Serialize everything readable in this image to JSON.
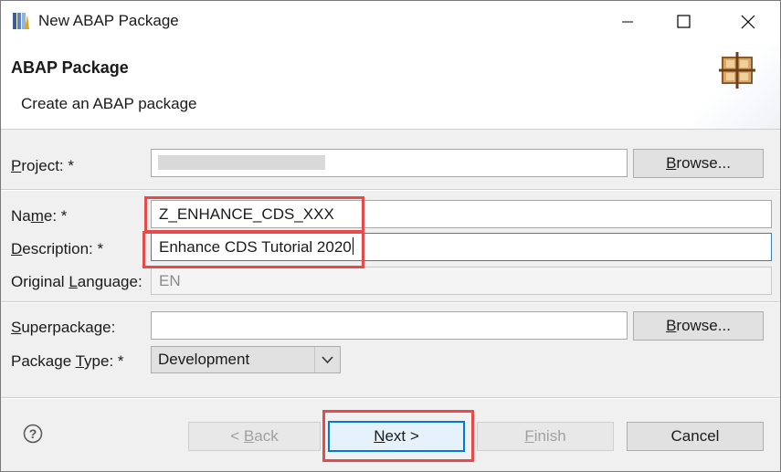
{
  "window": {
    "title": "New ABAP Package"
  },
  "header": {
    "title": "ABAP Package",
    "subtitle": "Create an ABAP package"
  },
  "form": {
    "project": {
      "label_u": "P",
      "label_rest": "roject: *",
      "value": ""
    },
    "name": {
      "label_pre": "Na",
      "label_u": "m",
      "label_rest": "e: *",
      "value": "Z_ENHANCE_CDS_XXX"
    },
    "description": {
      "label_u": "D",
      "label_rest": "escription: *",
      "value": "Enhance CDS Tutorial 2020"
    },
    "original_language": {
      "label_pre": "Original ",
      "label_u": "L",
      "label_rest": "anguage:",
      "value": "EN"
    },
    "superpackage": {
      "label_u": "S",
      "label_rest": "uperpackage:",
      "value": ""
    },
    "package_type": {
      "label_pre": "Package ",
      "label_u": "T",
      "label_rest": "ype: *",
      "value": "Development"
    },
    "browse_label_u": "B",
    "browse_label_rest": "rowse..."
  },
  "footer": {
    "back": {
      "pre": "< ",
      "u": "B",
      "rest": "ack"
    },
    "next": {
      "u": "N",
      "rest": "ext >"
    },
    "finish": {
      "u": "F",
      "rest": "inish"
    },
    "cancel": "Cancel"
  },
  "colors": {
    "highlight": "#e64b4b",
    "focus": "#0078d7"
  }
}
